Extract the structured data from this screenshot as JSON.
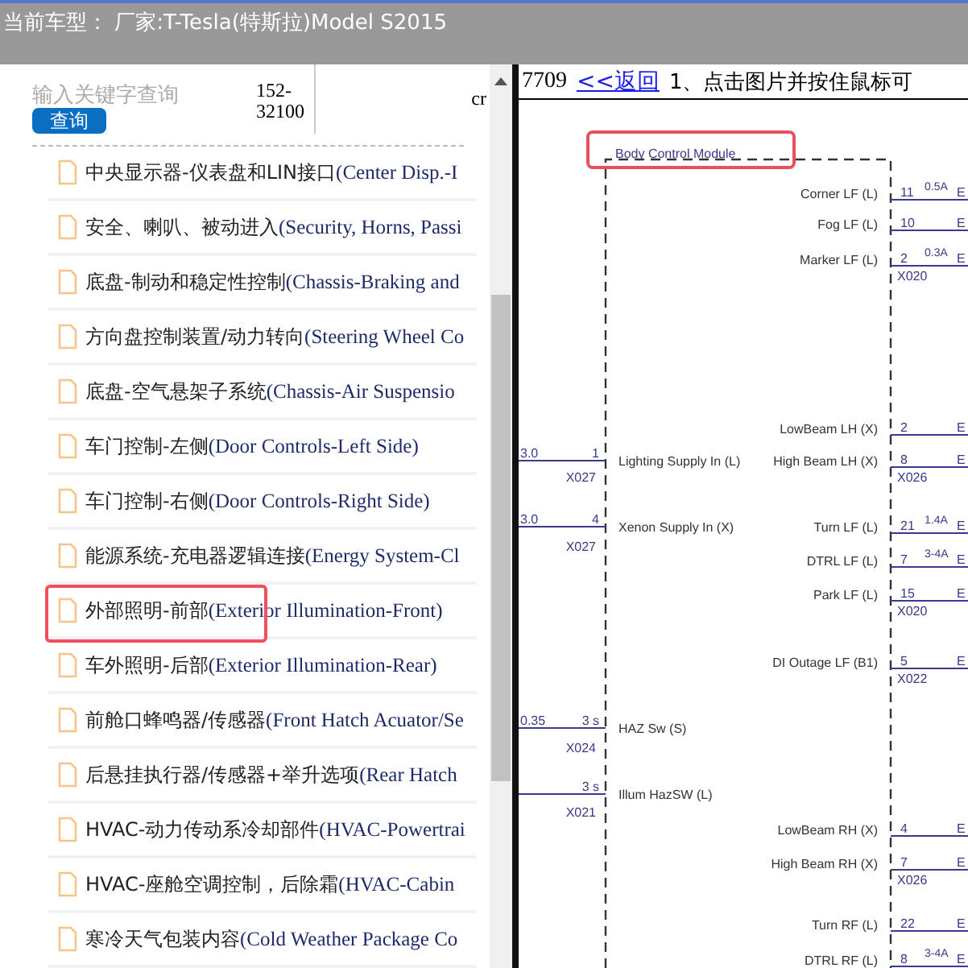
{
  "header": {
    "title": "当前车型： 厂家:T-Tesla(特斯拉)Model S2015"
  },
  "search": {
    "placeholder": "输入关键字查询",
    "button": "查询",
    "code": "152-32100",
    "cut_text": "cr"
  },
  "sidebar": {
    "items": [
      {
        "cn": "中央显示器-仪表盘和LIN接口",
        "en": "(Center Disp.-I",
        "highlighted": false
      },
      {
        "cn": "安全、喇叭、被动进入",
        "en": "(Security, Horns, Passi",
        "highlighted": false
      },
      {
        "cn": "底盘-制动和稳定性控制",
        "en": "(Chassis-Braking and",
        "highlighted": false
      },
      {
        "cn": "方向盘控制装置/动力转向",
        "en": "(Steering Wheel Co",
        "highlighted": false
      },
      {
        "cn": "底盘-空气悬架子系统",
        "en": "(Chassis-Air Suspensio",
        "highlighted": false
      },
      {
        "cn": "车门控制-左侧",
        "en": "(Door Controls-Left Side)",
        "highlighted": false
      },
      {
        "cn": "车门控制-右侧",
        "en": "(Door Controls-Right Side)",
        "highlighted": false
      },
      {
        "cn": "能源系统-充电器逻辑连接",
        "en": "(Energy System-Cl",
        "highlighted": false
      },
      {
        "cn": "外部照明-前部",
        "en": "(Exterior Illumination-Front)",
        "highlighted": true
      },
      {
        "cn": "车外照明-后部",
        "en": "(Exterior Illumination-Rear)",
        "highlighted": false
      },
      {
        "cn": "前舱口蜂鸣器/传感器",
        "en": "(Front Hatch Acuator/Se",
        "highlighted": false
      },
      {
        "cn": "后悬挂执行器/传感器+举升选项",
        "en": "(Rear Hatch",
        "highlighted": false
      },
      {
        "cn": "HVAC-动力传动系冷却部件",
        "en": "(HVAC-Powertrai",
        "highlighted": false
      },
      {
        "cn": "HVAC-座舱空调控制，后除霜",
        "en": "(HVAC-Cabin",
        "highlighted": false
      },
      {
        "cn": "寒冷天气包装内容",
        "en": "(Cold Weather Package Co",
        "highlighted": false
      }
    ]
  },
  "content_bar": {
    "number": "7709",
    "back_link": "<<返回",
    "instruction": "1、点击图片并按住鼠标可"
  },
  "diagram": {
    "module_title": "Body Control Module",
    "left_pins": [
      {
        "wire": "3.0",
        "pin": "1",
        "label": "Lighting Supply In (L)"
      },
      {
        "wire": "3.0",
        "pin": "4",
        "label": "Xenon Supply In (X)"
      },
      {
        "wire": "0.35",
        "pin": "3 s",
        "label": "HAZ Sw (S)"
      },
      {
        "pin": "3 s",
        "label": "Illum HazSW (L)"
      }
    ],
    "left_connectors": [
      "X027",
      "X027",
      "X024",
      "X021"
    ],
    "right_pins": [
      {
        "label": "Corner LF (L)",
        "pin": "11",
        "current": "0.5A",
        "end": "E"
      },
      {
        "label": "Fog LF (L)",
        "pin": "10",
        "end": "E"
      },
      {
        "label": "Marker LF (L)",
        "pin": "2",
        "current": "0.3A",
        "end": "E"
      },
      {
        "label": "LowBeam LH (X)",
        "pin": "2",
        "end": "E"
      },
      {
        "label": "High Beam LH (X)",
        "pin": "8",
        "end": "E"
      },
      {
        "label": "Turn LF (L)",
        "pin": "21",
        "current": "1.4A",
        "end": "E"
      },
      {
        "label": "DTRL LF (L)",
        "pin": "7",
        "current": "3-4A",
        "end": "E"
      },
      {
        "label": "Park LF (L)",
        "pin": "15",
        "end": "E"
      },
      {
        "label": "DI Outage LF (B1)",
        "pin": "5",
        "end": "E"
      },
      {
        "label": "LowBeam RH (X)",
        "pin": "4",
        "end": "E"
      },
      {
        "label": "High Beam RH (X)",
        "pin": "7",
        "end": "E"
      },
      {
        "label": "Turn RF (L)",
        "pin": "22",
        "end": "E"
      },
      {
        "label": "DTRL RF (L)",
        "pin": "8",
        "current": "3-4A",
        "end": "E"
      }
    ],
    "right_connectors": [
      "X020",
      "X026",
      "X020",
      "X022",
      "X026"
    ]
  }
}
